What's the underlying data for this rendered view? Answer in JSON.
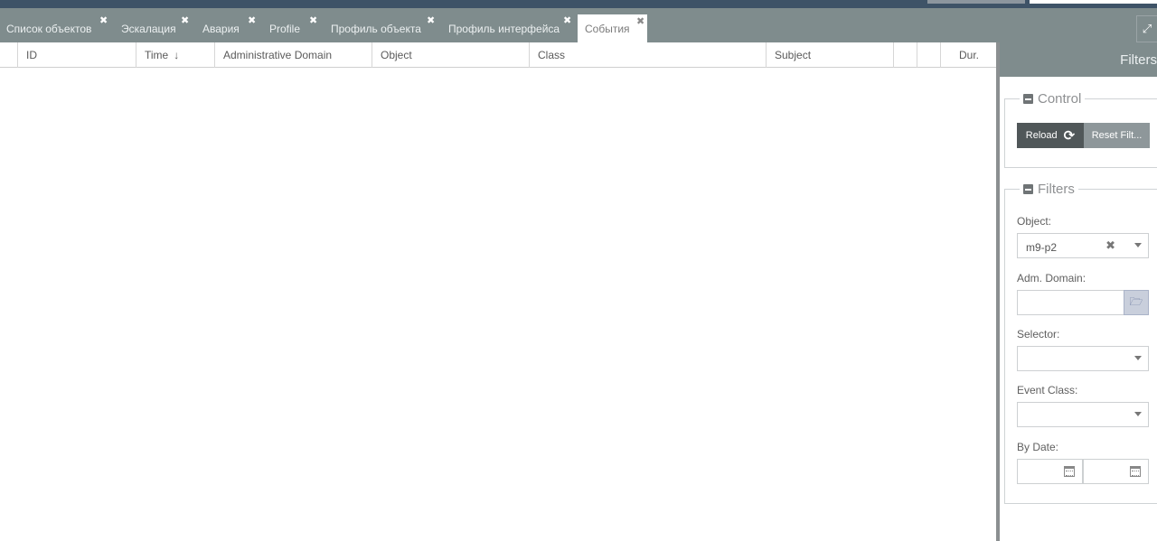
{
  "tabs": [
    {
      "label": "Список объектов",
      "active": false
    },
    {
      "label": "Эскалация",
      "active": false
    },
    {
      "label": "Авария",
      "active": false
    },
    {
      "label": "Profile",
      "active": false
    },
    {
      "label": "Профиль объекта",
      "active": false
    },
    {
      "label": "Профиль интерфейса",
      "active": false
    },
    {
      "label": "События",
      "active": true
    }
  ],
  "icons": {
    "close": "✖",
    "expand": "⤢",
    "sort_desc": "↓",
    "reload": "⟳",
    "clear": "✖",
    "folder": "🗁"
  },
  "grid": {
    "columns": [
      "",
      "ID",
      "Time",
      "Administrative Domain",
      "Object",
      "Class",
      "Subject",
      "",
      "",
      "Dur."
    ],
    "sorted_column": "Time",
    "rows": []
  },
  "panel": {
    "title": "Filters",
    "control": {
      "legend": "Control",
      "reload_label": "Reload",
      "reset_label": "Reset Filt..."
    },
    "filters": {
      "legend": "Filters",
      "object_label": "Object:",
      "object_value": "m9-p2",
      "adm_domain_label": "Adm. Domain:",
      "adm_domain_value": "",
      "selector_label": "Selector:",
      "selector_value": "",
      "event_class_label": "Event Class:",
      "event_class_value": "",
      "by_date_label": "By Date:",
      "date_from": "",
      "date_to": ""
    }
  },
  "colors": {
    "topbar": "#3e5367",
    "tabstrip": "#7f8c8d",
    "reload_button": "#505759",
    "reset_button": "#8e979a"
  }
}
